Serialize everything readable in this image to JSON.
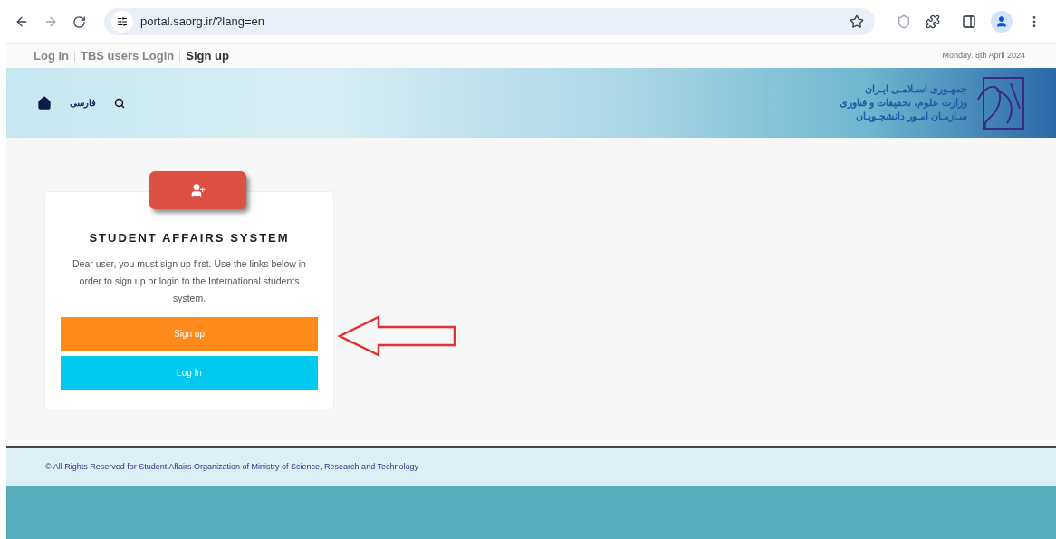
{
  "browser": {
    "url": "portal.saorg.ir/?lang=en"
  },
  "top_nav": {
    "links": [
      {
        "label": "Log In",
        "selected": false
      },
      {
        "label": "TBS users Login",
        "selected": false
      },
      {
        "label": "Sign up",
        "selected": true
      }
    ],
    "date": "Monday. 8th April 2024"
  },
  "header": {
    "language_link": "فارسی",
    "logo_lines": [
      "جمهـوری اسـلامـی ایـران",
      "وزارت علوم، تحقیقات و فناوری",
      "سـازمـان امـور دانشجـویـان"
    ]
  },
  "card": {
    "title": "STUDENT AFFAIRS SYSTEM",
    "message": "Dear user, you must sign up first. Use the links below in order to sign up or login to the International students system.",
    "buttons": [
      {
        "label": "Sign up",
        "kind": "signup"
      },
      {
        "label": "Log In",
        "kind": "login"
      }
    ]
  },
  "footer": {
    "copyright": "© All Rights Reserved for Student Affairs Organization of Ministry of Science, Research and Technology"
  }
}
